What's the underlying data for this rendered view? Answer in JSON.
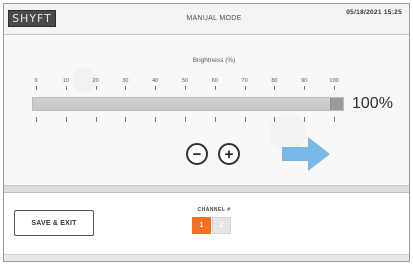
{
  "header": {
    "logo_text": "SHYFT",
    "mode_title": "MANUAL MODE",
    "datetime": "05/18/2021  15:25"
  },
  "brightness": {
    "label": "Brightness (%)",
    "scale_ticks": [
      "0",
      "10",
      "20",
      "30",
      "40",
      "50",
      "60",
      "70",
      "80",
      "90",
      "100"
    ],
    "value_text": "100%",
    "value": 100
  },
  "controls": {
    "decrease_symbol": "−",
    "increase_symbol": "+"
  },
  "footer": {
    "save_label": "SAVE & EXIT",
    "channel_label": "CHANNEL #",
    "channels": [
      {
        "label": "1",
        "active": true
      },
      {
        "label": "2",
        "active": false
      }
    ]
  },
  "colors": {
    "accent": "#f36f21",
    "arrow": "#7ab8e6"
  },
  "icons": {
    "arrow": "right-arrow-icon"
  }
}
